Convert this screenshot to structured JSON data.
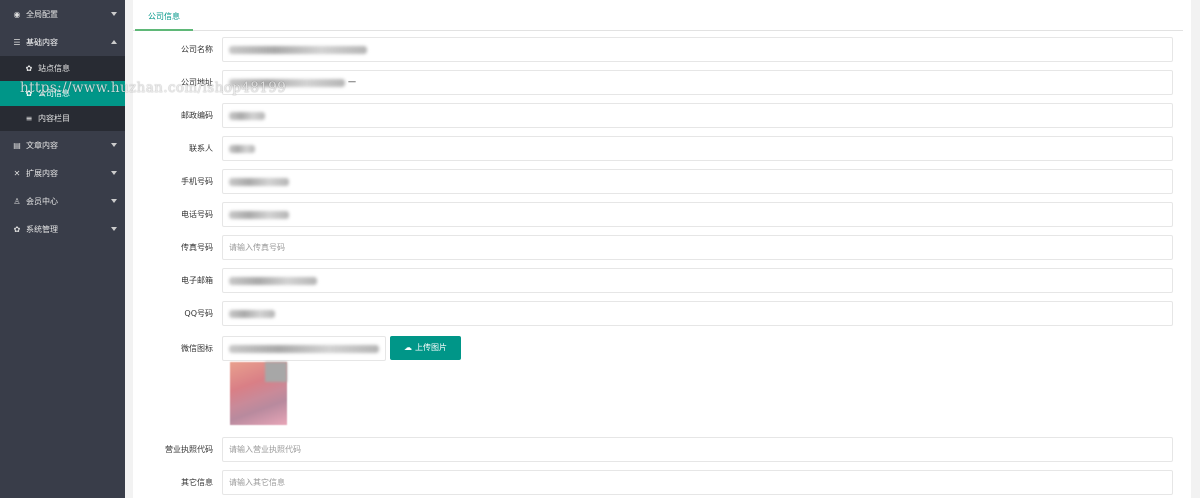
{
  "sidebar": {
    "items": [
      {
        "icon": "globe-icon",
        "glyph": "◉",
        "label": "全局配置"
      },
      {
        "icon": "sliders-icon",
        "glyph": "☰",
        "label": "基础内容"
      },
      {
        "icon": "document-icon",
        "glyph": "▤",
        "label": "文章内容"
      },
      {
        "icon": "extend-icon",
        "glyph": "✕",
        "label": "扩展内容"
      },
      {
        "icon": "user-icon",
        "glyph": "♙",
        "label": "会员中心"
      },
      {
        "icon": "gear-icon",
        "glyph": "✿",
        "label": "系统管理"
      }
    ],
    "subitems": [
      {
        "icon": "gear-icon",
        "glyph": "✿",
        "label": "站点信息"
      },
      {
        "icon": "gear-icon",
        "glyph": "✿",
        "label": "公司信息"
      },
      {
        "icon": "list-icon",
        "glyph": "≡",
        "label": "内容栏目"
      }
    ],
    "watermark": "https://www.huzhan.com/ishop48199"
  },
  "tabs": {
    "active": "公司信息"
  },
  "form": {
    "company_name": {
      "label": "公司名称"
    },
    "company_address": {
      "label": "公司地址",
      "visible_value": "一"
    },
    "postal_code": {
      "label": "邮政编码"
    },
    "contact": {
      "label": "联系人"
    },
    "mobile": {
      "label": "手机号码"
    },
    "phone": {
      "label": "电话号码"
    },
    "fax": {
      "label": "传真号码",
      "placeholder": "请输入传真号码"
    },
    "email": {
      "label": "电子邮箱"
    },
    "qq": {
      "label": "QQ号码"
    },
    "wechat_icon": {
      "label": "微信图标",
      "button": "上传图片",
      "button_icon": "cloud-upload-icon"
    },
    "business_license": {
      "label": "营业执照代码",
      "placeholder": "请输入营业执照代码"
    },
    "other_info": {
      "label": "其它信息",
      "placeholder": "请输入其它信息"
    }
  },
  "colors": {
    "sidebar": "#393d49",
    "subnav": "#282b33",
    "accent": "#009688",
    "tab_underline": "#5fb878"
  }
}
